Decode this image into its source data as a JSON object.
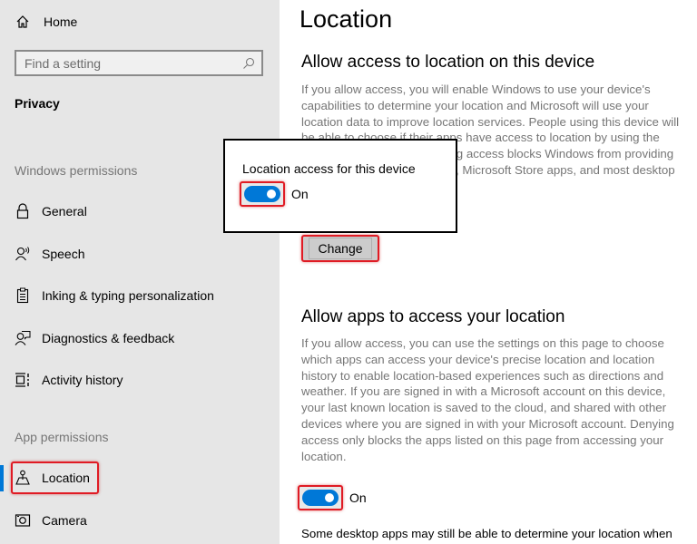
{
  "sidebar": {
    "home_label": "Home",
    "search_placeholder": "Find a setting",
    "section_title": "Privacy",
    "windows_permissions_label": "Windows permissions",
    "windows_items": [
      {
        "label": "General",
        "icon": "lock-icon"
      },
      {
        "label": "Speech",
        "icon": "speech-icon"
      },
      {
        "label": "Inking & typing personalization",
        "icon": "inking-icon"
      },
      {
        "label": "Diagnostics & feedback",
        "icon": "diagnostics-icon"
      },
      {
        "label": "Activity history",
        "icon": "activity-history-icon"
      }
    ],
    "app_permissions_label": "App permissions",
    "app_items": [
      {
        "label": "Location",
        "icon": "location-icon",
        "selected": true
      },
      {
        "label": "Camera",
        "icon": "camera-icon",
        "selected": false
      }
    ]
  },
  "main": {
    "page_title": "Location",
    "device_section": {
      "heading": "Allow access to location on this device",
      "description": "If you allow access, you will enable Windows to use your device's capabilities to determine your location and Microsoft will use your location data to improve location services. People using this device will be able to choose if their apps have access to location by using the settings on this page. Denying access blocks Windows from providing location to Windows features, Microsoft Store apps, and most desktop apps.",
      "change_button": "Change"
    },
    "popup": {
      "title": "Location access for this device",
      "toggle_state": "On",
      "toggle_on": true
    },
    "apps_section": {
      "heading": "Allow apps to access your location",
      "description": "If you allow access, you can use the settings on this page to choose which apps can access your device's precise location and location history to enable location-based experiences such as directions and weather. If you are signed in with a Microsoft account on this device, your last known location is saved to the cloud, and shared with other devices where you are signed in with your Microsoft account. Denying access only blocks the apps listed on this page from accessing your location.",
      "toggle_state": "On",
      "toggle_on": true,
      "footer_text": "Some desktop apps may still be able to determine your location when"
    }
  },
  "colors": {
    "accent": "#0078d7",
    "highlight_border": "#e01b24",
    "sidebar_bg": "#e6e6e6",
    "secondary_text": "#767676"
  }
}
